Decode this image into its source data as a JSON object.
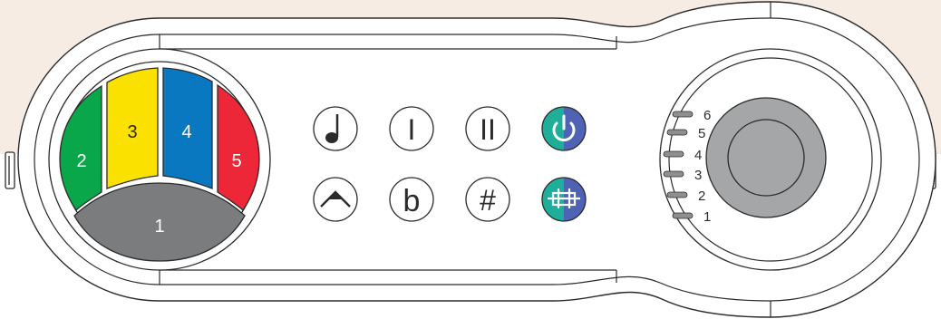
{
  "colors": {
    "background_top": "#f7ece4",
    "body_fill": "#ffffff",
    "outline": "#2b2b2b",
    "fret_green": "#0aa64a",
    "fret_yellow": "#fbe100",
    "fret_blue": "#0a78c0",
    "fret_red": "#ed2737",
    "fret_gray": "#7b7c7e",
    "power_teal": "#1fae9a",
    "power_blue": "#4f63b4",
    "knob_gray": "#a4a6a8",
    "led_gray": "#8d8f91"
  },
  "fret_pad": {
    "frets": [
      {
        "number": "2",
        "color": "green"
      },
      {
        "number": "3",
        "color": "yellow"
      },
      {
        "number": "4",
        "color": "blue"
      },
      {
        "number": "5",
        "color": "red"
      },
      {
        "number": "1",
        "color": "gray"
      }
    ]
  },
  "control_buttons": {
    "row1": [
      {
        "icon": "quarter-note-icon"
      },
      {
        "label": "I"
      },
      {
        "label": "II"
      },
      {
        "icon": "power-icon"
      }
    ],
    "row2": [
      {
        "icon": "caret-up-icon"
      },
      {
        "label": "b"
      },
      {
        "label": "#"
      },
      {
        "icon": "fret-connect-icon"
      }
    ]
  },
  "volume_dial": {
    "levels": [
      "6",
      "5",
      "4",
      "3",
      "2",
      "1"
    ]
  }
}
